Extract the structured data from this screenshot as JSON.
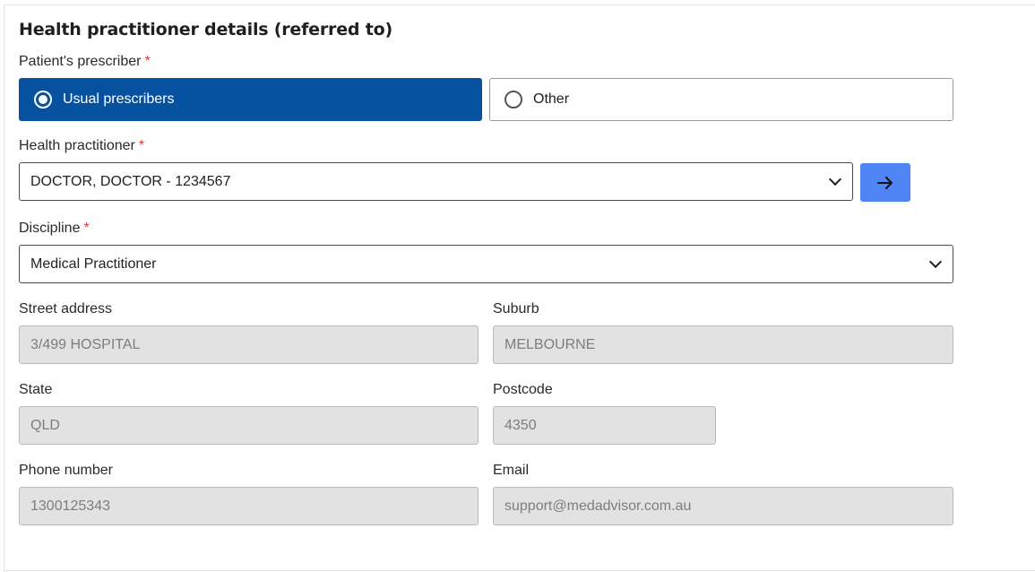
{
  "section": {
    "title": "Health practitioner details (referred to)"
  },
  "prescriber": {
    "label": "Patient's prescriber",
    "required_mark": "*",
    "options": [
      {
        "label": "Usual prescribers",
        "selected": true
      },
      {
        "label": "Other",
        "selected": false
      }
    ]
  },
  "practitioner": {
    "label": "Health practitioner",
    "required_mark": "*",
    "value": "DOCTOR, DOCTOR - 1234567",
    "go_icon": "arrow-right-icon"
  },
  "discipline": {
    "label": "Discipline",
    "required_mark": "*",
    "value": "Medical Practitioner"
  },
  "address": {
    "street": {
      "label": "Street address",
      "value": "3/499 HOSPITAL"
    },
    "suburb": {
      "label": "Suburb",
      "value": "MELBOURNE"
    },
    "state": {
      "label": "State",
      "value": "QLD"
    },
    "postcode": {
      "label": "Postcode",
      "value": "4350"
    },
    "phone": {
      "label": "Phone number",
      "value": "1300125343"
    },
    "email": {
      "label": "Email",
      "value": "support@medadvisor.com.au"
    }
  },
  "colors": {
    "primary": "#0652a0",
    "go_button": "#4f84f5",
    "required": "#d33b3b",
    "readonly_bg": "#e2e2e2"
  }
}
